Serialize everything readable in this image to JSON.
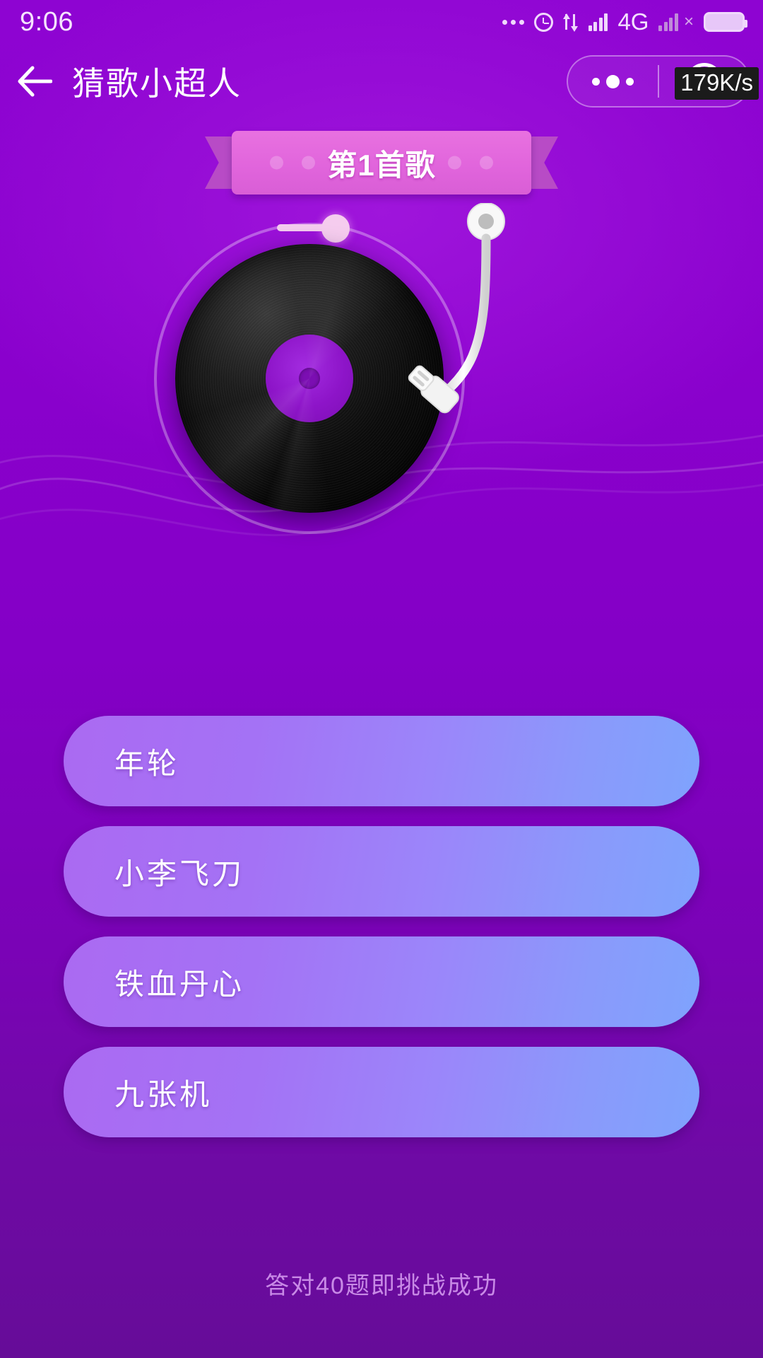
{
  "status_bar": {
    "time": "9:06",
    "network_type": "4G",
    "icons": [
      "more-dots-icon",
      "alarm-icon",
      "data-transfer-icon",
      "signal-bars-icon",
      "signal-bars-dim-icon",
      "battery-icon"
    ]
  },
  "nav_bar": {
    "back_icon": "back-arrow-icon",
    "title": "猜歌小超人",
    "capsule": {
      "more_icon": "more-dots-icon",
      "target_icon": "circle-target-icon"
    },
    "network_speed": "179K/s"
  },
  "ribbon": {
    "label": "第1首歌"
  },
  "player": {
    "record_icon": "vinyl-record-icon",
    "tonearm_icon": "tonearm-icon",
    "progress_dot_icon": "progress-dot-icon"
  },
  "options": [
    {
      "label": "年轮"
    },
    {
      "label": "小李飞刀"
    },
    {
      "label": "铁血丹心"
    },
    {
      "label": "九张机"
    }
  ],
  "footer": {
    "hint": "答对40题即挑战成功"
  },
  "colors": {
    "background_purple": "#8400c8",
    "ribbon_pink": "#e165dc",
    "ribbon_tail": "#b84bc6",
    "option_gradient_start": "#ab6af2",
    "option_gradient_end": "#7fa3fd",
    "footer_text": "#c88ae6",
    "accent_white": "#ffffff"
  }
}
